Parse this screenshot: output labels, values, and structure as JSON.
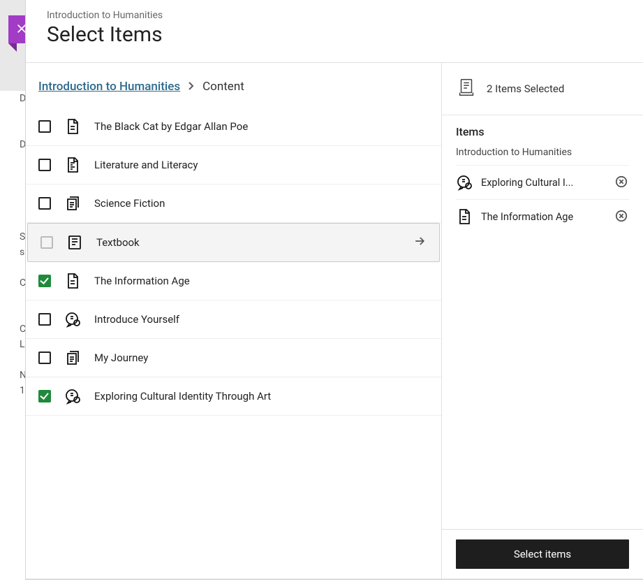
{
  "header": {
    "subtitle": "Introduction to Humanities",
    "title": "Select Items"
  },
  "breadcrumb": {
    "root": "Introduction to Humanities",
    "current": "Content"
  },
  "items": [
    {
      "label": "The Black Cat by Edgar Allan Poe",
      "icon": "document",
      "checked": false,
      "folder": false
    },
    {
      "label": "Literature and Literacy",
      "icon": "doc-lines",
      "checked": false,
      "folder": false
    },
    {
      "label": "Science Fiction",
      "icon": "doc-stack",
      "checked": false,
      "folder": false
    },
    {
      "label": "Textbook",
      "icon": "textbook",
      "checked": false,
      "folder": true
    },
    {
      "label": "The Information Age",
      "icon": "document",
      "checked": true,
      "folder": false
    },
    {
      "label": "Introduce Yourself",
      "icon": "discussion",
      "checked": false,
      "folder": false
    },
    {
      "label": "My Journey",
      "icon": "doc-stack",
      "checked": false,
      "folder": false
    },
    {
      "label": "Exploring Cultural Identity Through Art",
      "icon": "discussion",
      "checked": true,
      "folder": false
    }
  ],
  "selected": {
    "count_text": "2 Items Selected",
    "heading": "Items",
    "group": "Introduction to Humanities",
    "list": [
      {
        "label": "Exploring Cultural I...",
        "icon": "discussion"
      },
      {
        "label": "The Information Age",
        "icon": "document"
      }
    ]
  },
  "footer": {
    "button": "Select items"
  },
  "bg_hints": [
    "D",
    "D",
    "S",
    "s",
    "C",
    "C",
    "L",
    "N",
    "1"
  ]
}
